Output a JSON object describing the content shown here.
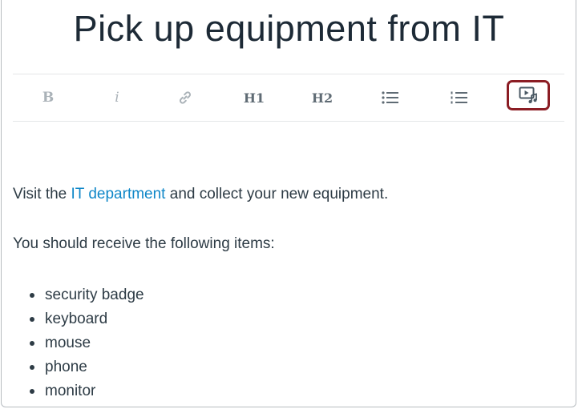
{
  "page": {
    "title": "Pick up equipment from IT"
  },
  "toolbar": {
    "bold_label": "B",
    "italic_label": "i",
    "h1_label": "H1",
    "h2_label": "H2",
    "icons": [
      "bold-icon",
      "italic-icon",
      "link-icon",
      "heading1-icon",
      "heading2-icon",
      "bulleted-list-icon",
      "numbered-list-icon",
      "media-icon"
    ],
    "highlight_color": "#8b1d24"
  },
  "content": {
    "intro_prefix": "Visit the ",
    "intro_link": "IT department",
    "intro_suffix": " and collect your new equipment.",
    "items_heading": "You should receive the following items:",
    "items": [
      "security badge",
      "keyboard",
      "mouse",
      "phone",
      "monitor"
    ]
  },
  "colors": {
    "link": "#0f87c8",
    "text": "#2d3b45"
  }
}
